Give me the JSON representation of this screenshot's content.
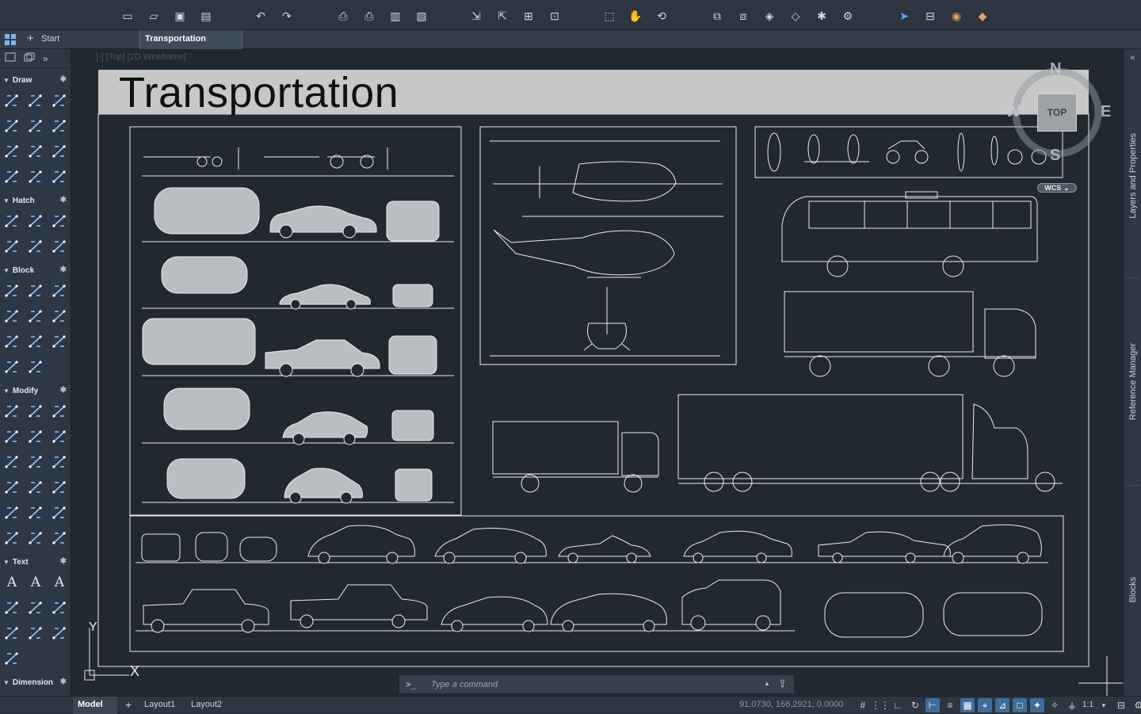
{
  "toolbar": {
    "groups": [
      [
        "new-icon",
        "open-icon",
        "save-icon",
        "save-as-icon"
      ],
      [
        "undo-icon",
        "redo-icon"
      ],
      [
        "plot-icon",
        "batch-plot-icon",
        "publish-icon",
        "export-pdf-icon"
      ],
      [
        "import-icon",
        "export-icon",
        "attach-icon",
        "share-icon"
      ],
      [
        "zoom-window-icon",
        "pan-icon",
        "orbit-icon"
      ],
      [
        "layer-properties-icon",
        "layer-states-icon",
        "match-layer-icon",
        "layer-isolate-icon",
        "layer-freeze-icon",
        "layer-settings-icon"
      ],
      [
        "send-icon",
        "viewport-icon",
        "notifications-icon",
        "app-store-icon"
      ]
    ]
  },
  "tabs": {
    "start": "Start",
    "active": "Transportation",
    "new_tab_symbol": "+"
  },
  "palette": {
    "sections": [
      {
        "label": "Draw",
        "icons": [
          "line-icon",
          "polyline-icon",
          "circle-icon",
          "rectangle-icon",
          "arc-icon",
          "spline-icon",
          "multiline-icon",
          "ray-icon",
          "ellipse-icon",
          "polygon-icon",
          "xline-icon",
          "revcloud-icon"
        ]
      },
      {
        "label": "Hatch",
        "icons": [
          "hatch-icon",
          "gradient-icon",
          "boundary-icon",
          "region-icon",
          "wipeout-icon",
          "image-icon"
        ]
      },
      {
        "label": "Block",
        "icons": [
          "insert-block-icon",
          "create-block-icon",
          "edit-block-icon",
          "define-attributes-icon",
          "tag-icon",
          "attribute-manager-icon",
          "block-editor-icon",
          "wblock-icon",
          "sync-block-icon",
          "base-point-icon",
          "attribute-edit-icon"
        ]
      },
      {
        "label": "Modify",
        "icons": [
          "move-icon",
          "copy-icon",
          "mirror-icon",
          "rotate-icon",
          "scale-icon",
          "trim-icon",
          "fillet-icon",
          "offset-icon",
          "array-icon",
          "erase-icon",
          "stretch-icon",
          "explode-icon",
          "chamfer-icon",
          "break-icon",
          "join-icon",
          "edit-polyline-icon",
          "align-icon",
          "lengthen-icon"
        ]
      },
      {
        "label": "Text",
        "icons": [
          "text-icon",
          "text-edit-icon",
          "mtext-icon",
          "find-icon",
          "spell-check-icon",
          "search-text-icon",
          "table-icon",
          "text-style-icon",
          "pdf-text-icon",
          "pdf-import-icon"
        ]
      },
      {
        "label": "Dimension",
        "icons": [
          "linear-dimension-icon",
          "dimension-style-icon"
        ]
      }
    ]
  },
  "viewport": {
    "label": "[-] [Top] [2D Wireframe]",
    "drawing_title": "Transportation"
  },
  "viewcube": {
    "north": "N",
    "south": "S",
    "east": "E",
    "west": "W",
    "face": "TOP",
    "wcs_label": "WCS"
  },
  "ucs": {
    "x_label": "X",
    "y_label": "Y"
  },
  "right_rail": {
    "panels": [
      "Layers and Properties",
      "Reference Manager",
      "Blocks"
    ]
  },
  "command": {
    "prompt": ">_",
    "placeholder": "Type a command"
  },
  "status": {
    "tabs": [
      "Model",
      "Layout1",
      "Layout2"
    ],
    "add_layout_symbol": "+",
    "coordinates": "91.0730, 166.2921, 0.0000",
    "scale": "1:1"
  },
  "colors": {
    "background": "#212830",
    "panel": "#2e3844",
    "accent": "#3f6d9a",
    "linework": "#e8ecef",
    "title_band": "#c7c7c7"
  }
}
